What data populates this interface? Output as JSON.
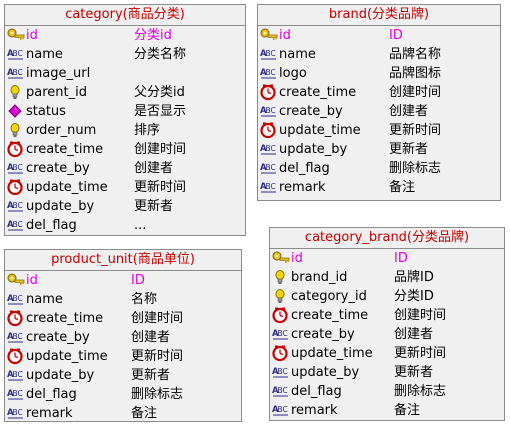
{
  "tables": [
    {
      "title": "category(商品分类)",
      "rows": [
        {
          "icon": "key-icon",
          "name": "id",
          "comment": "分类id",
          "pk": true
        },
        {
          "icon": "abc-text-icon",
          "name": "name",
          "comment": "分类名称"
        },
        {
          "icon": "abc-text-icon",
          "name": "image_url",
          "comment": ""
        },
        {
          "icon": "bulb-icon",
          "name": "parent_id",
          "comment": "父分类id"
        },
        {
          "icon": "diamond-icon",
          "name": "status",
          "comment": "是否显示"
        },
        {
          "icon": "bulb-icon",
          "name": "order_num",
          "comment": "排序"
        },
        {
          "icon": "clock-icon",
          "name": "create_time",
          "comment": "创建时间"
        },
        {
          "icon": "abc-text-icon",
          "name": "create_by",
          "comment": "创建者"
        },
        {
          "icon": "clock-icon",
          "name": "update_time",
          "comment": "更新时间"
        },
        {
          "icon": "abc-text-icon",
          "name": "update_by",
          "comment": "更新者"
        },
        {
          "icon": "abc-text-icon",
          "name": "del_flag",
          "comment": "..."
        }
      ]
    },
    {
      "title": "brand(分类品牌)",
      "rows": [
        {
          "icon": "key-icon",
          "name": "id",
          "comment": "ID",
          "pk": true
        },
        {
          "icon": "abc-text-icon",
          "name": "name",
          "comment": "品牌名称"
        },
        {
          "icon": "abc-text-icon",
          "name": "logo",
          "comment": "品牌图标"
        },
        {
          "icon": "clock-icon",
          "name": "create_time",
          "comment": "创建时间"
        },
        {
          "icon": "abc-text-icon",
          "name": "create_by",
          "comment": "创建者"
        },
        {
          "icon": "clock-icon",
          "name": "update_time",
          "comment": "更新时间"
        },
        {
          "icon": "abc-text-icon",
          "name": "update_by",
          "comment": "更新者"
        },
        {
          "icon": "abc-text-icon",
          "name": "del_flag",
          "comment": "删除标志"
        },
        {
          "icon": "abc-text-icon",
          "name": "remark",
          "comment": "备注"
        }
      ]
    },
    {
      "title": "product_unit(商品单位)",
      "rows": [
        {
          "icon": "key-icon",
          "name": "id",
          "comment": "ID",
          "pk": true
        },
        {
          "icon": "abc-text-icon",
          "name": "name",
          "comment": "名称"
        },
        {
          "icon": "clock-icon",
          "name": "create_time",
          "comment": "创建时间"
        },
        {
          "icon": "abc-text-icon",
          "name": "create_by",
          "comment": "创建者"
        },
        {
          "icon": "clock-icon",
          "name": "update_time",
          "comment": "更新时间"
        },
        {
          "icon": "abc-text-icon",
          "name": "update_by",
          "comment": "更新者"
        },
        {
          "icon": "abc-text-icon",
          "name": "del_flag",
          "comment": "删除标志"
        },
        {
          "icon": "abc-text-icon",
          "name": "remark",
          "comment": "备注"
        }
      ]
    },
    {
      "title": "category_brand(分类品牌)",
      "rows": [
        {
          "icon": "key-icon",
          "name": "id",
          "comment": "ID",
          "pk": true
        },
        {
          "icon": "bulb-icon",
          "name": "brand_id",
          "comment": "品牌ID"
        },
        {
          "icon": "bulb-icon",
          "name": "category_id",
          "comment": "分类ID"
        },
        {
          "icon": "clock-icon",
          "name": "create_time",
          "comment": "创建时间"
        },
        {
          "icon": "abc-text-icon",
          "name": "create_by",
          "comment": "创建者"
        },
        {
          "icon": "clock-icon",
          "name": "update_time",
          "comment": "更新时间"
        },
        {
          "icon": "abc-text-icon",
          "name": "update_by",
          "comment": "更新者"
        },
        {
          "icon": "abc-text-icon",
          "name": "del_flag",
          "comment": "删除标志"
        },
        {
          "icon": "abc-text-icon",
          "name": "remark",
          "comment": "备注"
        }
      ]
    }
  ]
}
